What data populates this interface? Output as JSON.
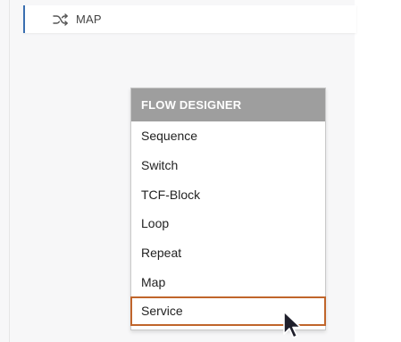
{
  "canvas": {
    "node": {
      "icon": "shuffle-icon",
      "label": "MAP"
    }
  },
  "flow_menu": {
    "title": "FLOW DESIGNER",
    "items": [
      {
        "label": "Sequence"
      },
      {
        "label": "Switch"
      },
      {
        "label": "TCF-Block"
      },
      {
        "label": "Loop"
      },
      {
        "label": "Repeat"
      },
      {
        "label": "Map"
      },
      {
        "label": "Service",
        "highlighted": true
      }
    ]
  },
  "colors": {
    "header_bg": "#9e9e9e",
    "highlight_border": "#c0652b",
    "node_accent": "#3a6fb0"
  }
}
